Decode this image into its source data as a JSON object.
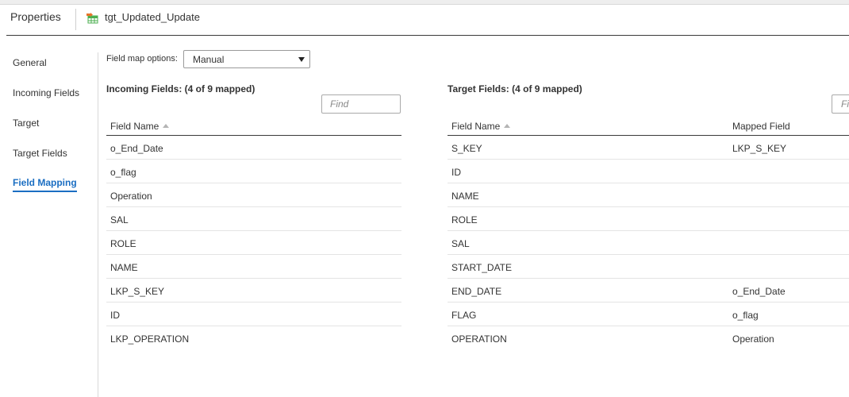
{
  "header": {
    "title": "Properties",
    "object_name": "tgt_Updated_Update",
    "object_icon": "target-table-icon"
  },
  "nav": {
    "items": [
      {
        "label": "General",
        "active": false
      },
      {
        "label": "Incoming Fields",
        "active": false
      },
      {
        "label": "Target",
        "active": false
      },
      {
        "label": "Target Fields",
        "active": false
      },
      {
        "label": "Field Mapping",
        "active": true
      }
    ]
  },
  "field_map": {
    "label": "Field map options:",
    "selected": "Manual"
  },
  "incoming": {
    "title": "Incoming Fields: (4 of 9 mapped)",
    "find_placeholder": "Find",
    "col_field_name": "Field Name",
    "rows": [
      "o_End_Date",
      "o_flag",
      "Operation",
      "SAL",
      "ROLE",
      "NAME",
      "LKP_S_KEY",
      "ID",
      "LKP_OPERATION"
    ]
  },
  "target": {
    "title": "Target Fields: (4 of 9 mapped)",
    "find_placeholder": "Fi",
    "col_field_name": "Field Name",
    "col_mapped_field": "Mapped Field",
    "rows": [
      {
        "field": "S_KEY",
        "mapped": "LKP_S_KEY"
      },
      {
        "field": "ID",
        "mapped": ""
      },
      {
        "field": "NAME",
        "mapped": ""
      },
      {
        "field": "ROLE",
        "mapped": ""
      },
      {
        "field": "SAL",
        "mapped": ""
      },
      {
        "field": "START_DATE",
        "mapped": ""
      },
      {
        "field": "END_DATE",
        "mapped": "o_End_Date"
      },
      {
        "field": "FLAG",
        "mapped": "o_flag"
      },
      {
        "field": "OPERATION",
        "mapped": "Operation"
      }
    ]
  },
  "colors": {
    "accent": "#1b6ec2",
    "icon_green": "#4caf50",
    "icon_orange": "#e8742a"
  }
}
